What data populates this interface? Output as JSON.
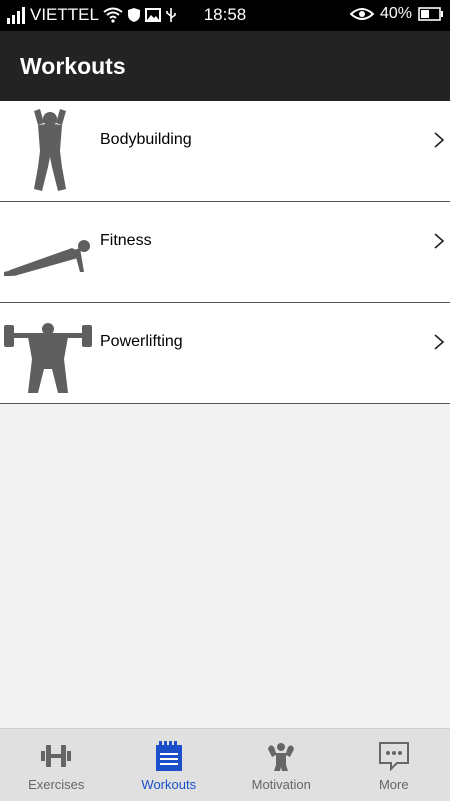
{
  "status_bar": {
    "carrier": "VIETTEL",
    "time": "18:58",
    "battery": "40%"
  },
  "header": {
    "title": "Workouts"
  },
  "workouts": [
    {
      "label": "Bodybuilding",
      "icon": "bodybuilder-pose-icon"
    },
    {
      "label": "Fitness",
      "icon": "pushup-icon"
    },
    {
      "label": "Powerlifting",
      "icon": "powerlifter-icon"
    }
  ],
  "tabs": [
    {
      "label": "Exercises",
      "icon": "dumbbell-icon",
      "active": false
    },
    {
      "label": "Workouts",
      "icon": "calendar-icon",
      "active": true
    },
    {
      "label": "Motivation",
      "icon": "muscle-man-icon",
      "active": false
    },
    {
      "label": "More",
      "icon": "chat-dots-icon",
      "active": false
    }
  ],
  "colors": {
    "accent": "#1a4fc9",
    "app_bar": "#232323",
    "status_bar": "#000000",
    "background": "#f2f2f2"
  }
}
